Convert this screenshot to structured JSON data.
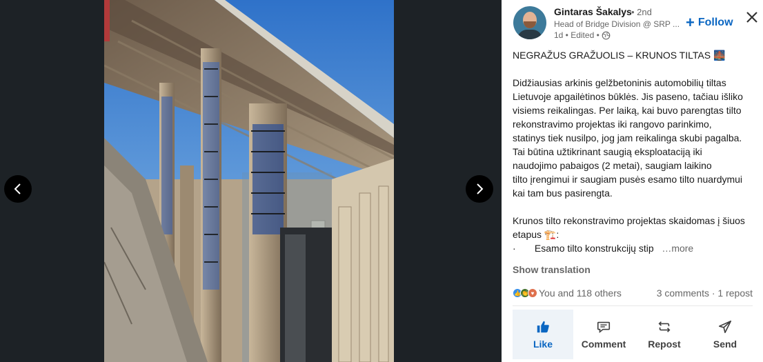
{
  "viewer": {
    "prev_icon": "chevron-left-icon",
    "next_icon": "chevron-right-icon"
  },
  "author": {
    "name": "Gintaras Šakalys",
    "degree": "• 2nd",
    "headline": "Head of Bridge Division @ SRP ...",
    "meta": "1d • Edited •",
    "visibility_icon": "globe-icon",
    "follow_label": "Follow"
  },
  "post": {
    "title": "NEGRAŽUS GRAŽUOLIS – KRUNOS TILTAS 🌉",
    "para1": [
      "Didžiausias arkinis gelžbetoninis automobilių tiltas",
      "Lietuvoje apgailėtinos būklės. Jis paseno, tačiau išliko",
      "visiems reikalingas. Per laiką, kai buvo parengtas tilto",
      "rekonstravimo projektas iki rangovo parinkimo,",
      "statinys tiek nusilpo, jog jam reikalinga skubi pagalba.",
      "Tai būtina užtikrinant saugią eksploataciją iki",
      "naudojimo pabaigos (2 metai), saugiam laikino",
      "tilto įrengimui ir saugiam pusės esamo tilto nuardymui",
      "kai tam bus pasirengta."
    ],
    "para2": [
      "Krunos tilto rekonstravimo projektas skaidomas į šiuos",
      "etapus 🏗️:"
    ],
    "bullet_marker": "·",
    "bullet_text": "Esamo tilto konstrukcijų stip",
    "more_label": "…more",
    "translate_label": "Show translation"
  },
  "social": {
    "reactions_text": "You and 118 others",
    "counts_text": "3 comments · 1 repost",
    "reaction_icons": [
      "like-icon",
      "celebrate-icon",
      "love-icon"
    ]
  },
  "actions": [
    {
      "label": "Like",
      "icon": "thumbs-up-icon",
      "active": true
    },
    {
      "label": "Comment",
      "icon": "comment-icon",
      "active": false
    },
    {
      "label": "Repost",
      "icon": "repost-icon",
      "active": false
    },
    {
      "label": "Send",
      "icon": "send-icon",
      "active": false
    }
  ],
  "colors": {
    "accent": "#0a66c2",
    "viewer_bg": "#1d2226",
    "muted": "#666666"
  }
}
